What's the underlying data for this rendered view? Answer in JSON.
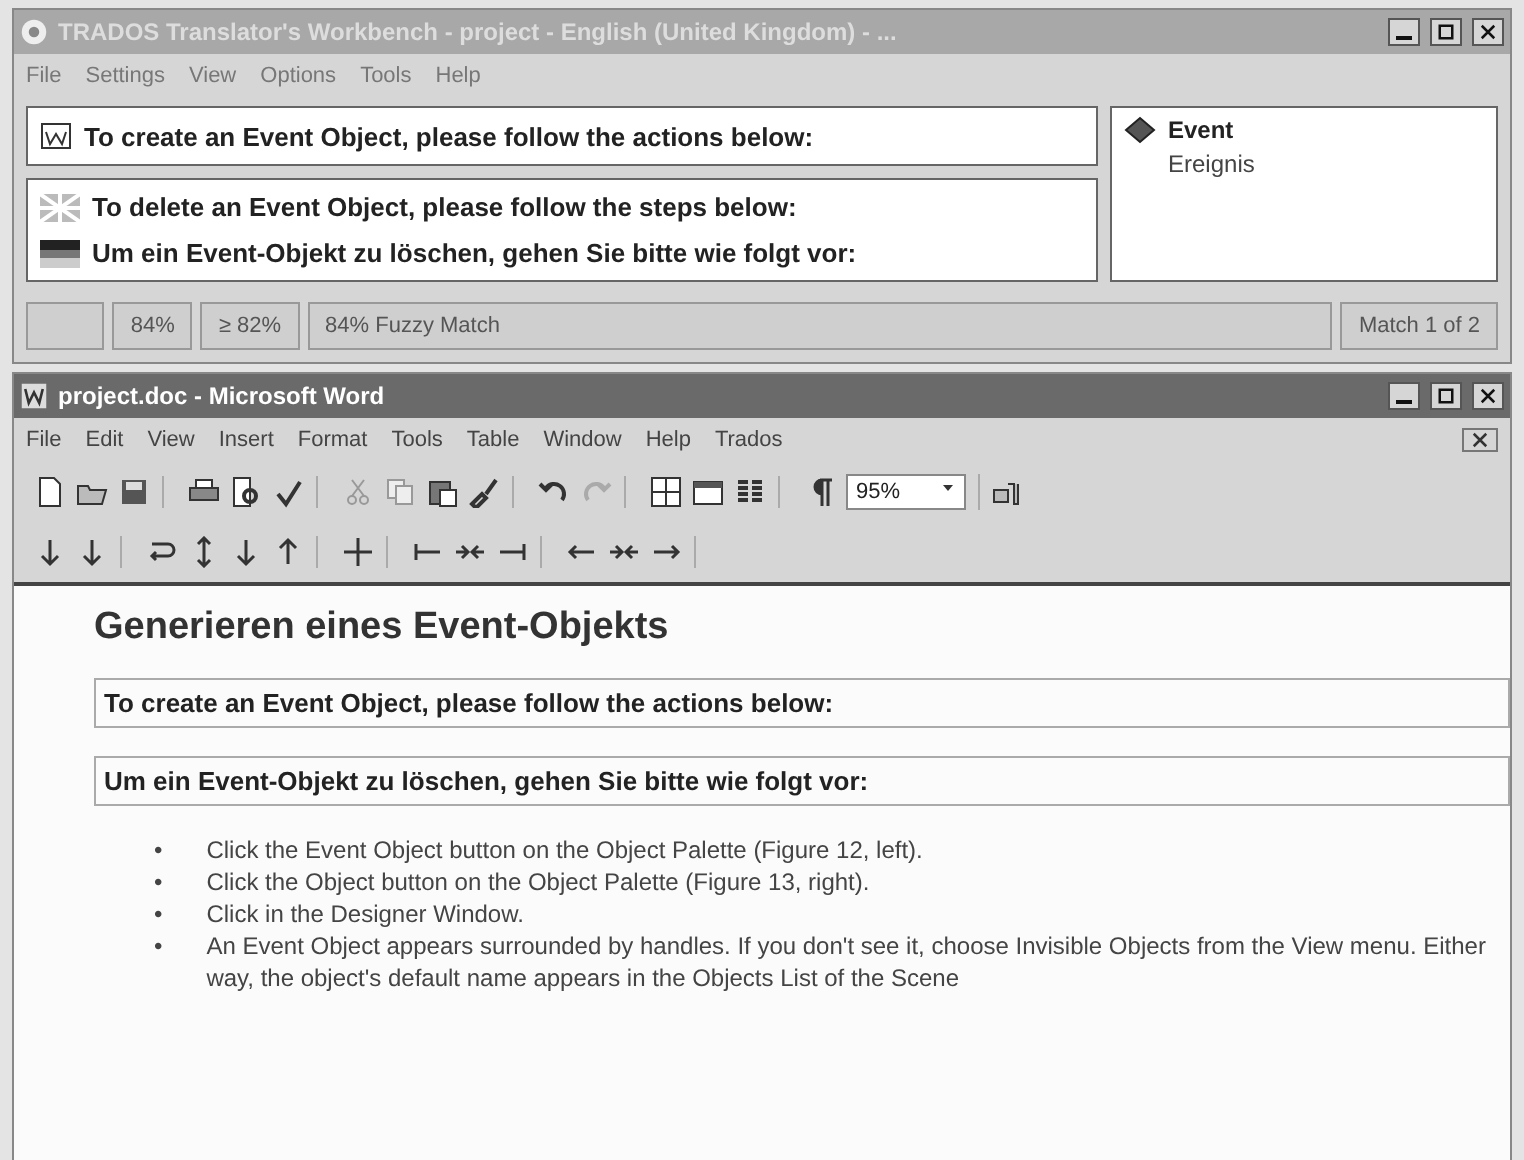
{
  "workbench": {
    "title": "TRADOS Translator's Workbench - project - English (United Kingdom) - ...",
    "menu": [
      "File",
      "Settings",
      "View",
      "Options",
      "Tools",
      "Help"
    ],
    "source_segment": "To create an Event Object, please follow the actions below:",
    "tm_source": "To delete an Event Object, please follow the steps below:",
    "tm_target": "Um ein Event-Objekt zu löschen, gehen Sie bitte wie folgt vor:",
    "termbase": {
      "term": "Event",
      "translation": "Ereignis"
    },
    "status_bar": [
      "84%",
      "≥ 82%",
      "84% Fuzzy Match",
      "Match 1 of 2"
    ]
  },
  "word": {
    "title": "project.doc - Microsoft Word",
    "menu": [
      "File",
      "Edit",
      "View",
      "Insert",
      "Format",
      "Tools",
      "Table",
      "Window",
      "Help",
      "Trados"
    ],
    "zoom": "95%",
    "document": {
      "heading": "Generieren eines Event-Objekts",
      "segments": [
        "To create an Event Object, please follow the actions below:",
        "Um ein Event-Objekt zu löschen, gehen Sie bitte wie folgt vor:"
      ],
      "bullets": [
        {
          "marker": "•",
          "text": "Click the Event Object button on the Object Palette (Figure 12, left)."
        },
        {
          "marker": "•",
          "text": "Click the Object button on the Object Palette (Figure 13, right)."
        },
        {
          "marker": "•",
          "text": "Click in the Designer Window."
        },
        {
          "marker": "•",
          "text": "An Event Object appears surrounded by handles. If you don't see it, choose Invisible Objects from the View menu. Either way, the object's default name appears in the Objects List of the Scene"
        }
      ]
    }
  }
}
